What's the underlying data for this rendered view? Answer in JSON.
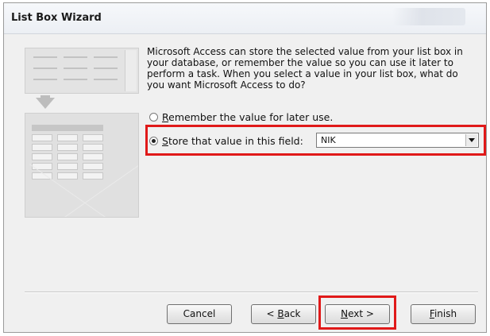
{
  "window": {
    "title": "List Box Wizard"
  },
  "description": "Microsoft Access can store the selected value from your list box in your database, or remember the value so you can use it later to perform a task.  When you select a value in your list box, what do you want Microsoft Access to do?",
  "options": {
    "remember": {
      "label_accel": "R",
      "label_rest": "emember the value for later use.",
      "selected": false
    },
    "store": {
      "label_accel": "S",
      "label_rest": "tore that value in this field:",
      "selected": true
    }
  },
  "field_select": {
    "value": "NIK"
  },
  "buttons": {
    "cancel": "Cancel",
    "back": {
      "prefix": "< ",
      "accel": "B",
      "rest": "ack"
    },
    "next": {
      "accel": "N",
      "rest": "ext >"
    },
    "finish": {
      "accel": "F",
      "rest": "inish"
    }
  },
  "colors": {
    "highlight": "#e01919"
  }
}
